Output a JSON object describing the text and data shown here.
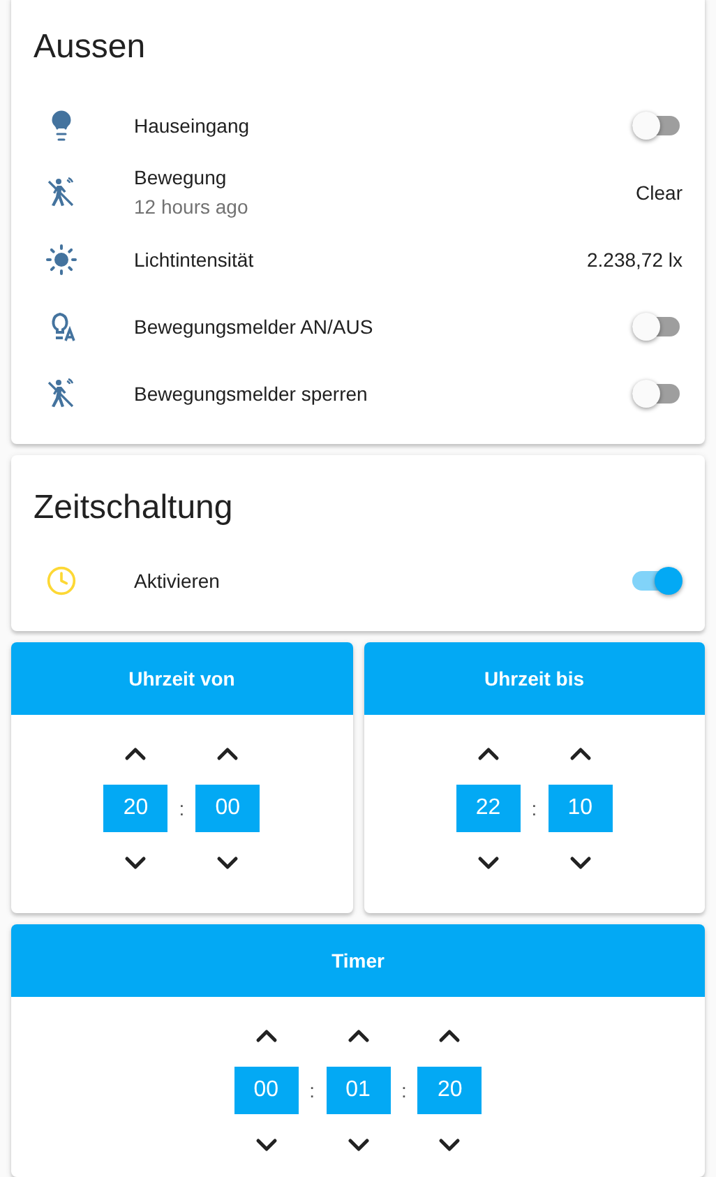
{
  "aussen": {
    "title": "Aussen",
    "rows": [
      {
        "kind": "toggle",
        "name": "Hauseingang",
        "on": false
      },
      {
        "kind": "state",
        "name": "Bewegung",
        "secondary": "12 hours ago",
        "value": "Clear"
      },
      {
        "kind": "state",
        "name": "Lichtintensität",
        "value": "2.238,72 lx"
      },
      {
        "kind": "toggle",
        "name": "Bewegungsmelder AN/AUS",
        "on": false
      },
      {
        "kind": "toggle",
        "name": "Bewegungsmelder sperren",
        "on": false
      }
    ]
  },
  "zeitschaltung": {
    "title": "Zeitschaltung",
    "rows": [
      {
        "kind": "toggle",
        "name": "Aktivieren",
        "on": true
      }
    ]
  },
  "time_cards": [
    {
      "title": "Uhrzeit von",
      "separator": ":",
      "fields": [
        "20",
        "00"
      ]
    },
    {
      "title": "Uhrzeit bis",
      "separator": ":",
      "fields": [
        "22",
        "10"
      ]
    }
  ],
  "timer": {
    "title": "Timer",
    "separator": ":",
    "fields": [
      "00",
      "01",
      "20"
    ]
  }
}
